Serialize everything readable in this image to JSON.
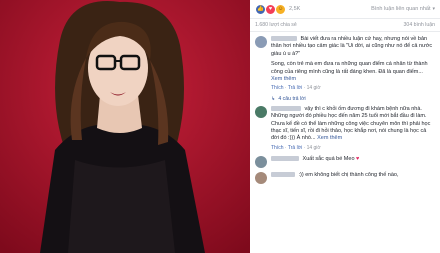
{
  "reactions": {
    "count": "2,5K",
    "icons": [
      "like-icon",
      "love-icon",
      "haha-icon"
    ]
  },
  "sort_label": "Bình luận liên quan nhất",
  "shares": {
    "left": "1.680 lượt chia sẻ",
    "right": "304 bình luận"
  },
  "comments": [
    {
      "text": "Bài viết đưa ra nhiều luận cứ hay, nhưng nói về bản thân hơi nhiều tạo cảm giác là \"Ui dời, ai cũng như nó để cả nước giàu ú u à?\"",
      "text2": "Song, còn trẻ mà em đưa ra những quan điểm cá nhân từ thành công của riêng mình cũng là rất đáng khen. Đã là quan điểm...",
      "more": "Xem thêm",
      "like": "Thích",
      "reply": "Trả lời",
      "time": "14 giờ",
      "avatar_color": "#8a9bb5"
    },
    {
      "text": "vậy thì c khỏi ốm đương đi khám bệnh nữa nhà. Những người đó phiều học đến năm 25 tuổi mới bắt đầu đi làm. Chưa kể đề có thể làm những công việc chuyên môn thì phải học thạc sĩ, tiến sĩ, rồi đi hỏi thảo, học khắp nơi, nói chung là học cả đời đó :))) À nhò...",
      "more": "Xem thêm",
      "like": "Thích",
      "reply": "Trả lời",
      "time": "14 giờ",
      "avatar_color": "#4a7a66"
    },
    {
      "text": "Xuất sắc quá bé Meo",
      "emoji": "♥",
      "avatar_color": "#7b8f9c"
    },
    {
      "text": ":)) em không biết chị thành công thế nào,",
      "avatar_color": "#a58a7a"
    }
  ],
  "replies_label": "4 câu trả lời",
  "actions_sep": "·"
}
